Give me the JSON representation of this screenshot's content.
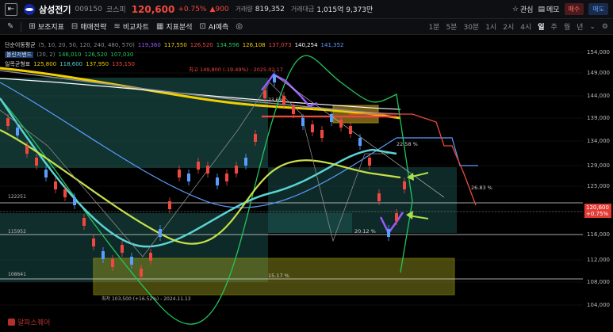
{
  "header": {
    "collapse_icon": "arrow-left-collapse-icon",
    "logo": "samsung-logo",
    "name": "삼성전기",
    "code": "009150",
    "market": "코스피",
    "price": "120,600",
    "change_pct": "+0.75%",
    "change_abs": "▲900",
    "volume_label": "거래량",
    "volume": "819,352",
    "amount_label": "거래대금",
    "amount": "1,015억 9,373만",
    "interest_label": "관심",
    "memo_label": "메모",
    "buy_label": "매수",
    "sell_label": "매도",
    "colors": {
      "up": "#f0483f",
      "down": "#5b9dff",
      "background": "#000000"
    }
  },
  "toolbar": {
    "items": [
      {
        "icon": "ruler-icon",
        "label": ""
      },
      {
        "icon": "indicator-icon",
        "label": "보조지표"
      },
      {
        "icon": "strategy-icon",
        "label": "매매전략"
      },
      {
        "icon": "compare-icon",
        "label": "비교차트"
      },
      {
        "icon": "analysis-icon",
        "label": "지표분석"
      },
      {
        "icon": "ai-icon",
        "label": "AI예측"
      },
      {
        "icon": "camera-icon",
        "label": ""
      }
    ],
    "timeframes": [
      "1분",
      "5분",
      "30분",
      "1시",
      "2시",
      "4시",
      "일",
      "주",
      "월",
      "년"
    ],
    "active_timeframe": "일",
    "dropdown_icon": "chevron-down-icon",
    "settings_icon": "gear-icon"
  },
  "legend": {
    "sma_label": "단순이동평균",
    "sma_params": "(5, 10, 20, 50, 120, 240, 480, 570)",
    "sma_values": [
      "119,360",
      "117,550",
      "126,520",
      "134,596",
      "126,108",
      "137,073",
      "140,254",
      "141,352"
    ],
    "sma_colors": [
      "#9b59ff",
      "#f0d000",
      "#f0483f",
      "#22c55e",
      "#f0d000",
      "#f0483f",
      "#ffffff",
      "#5b9dff"
    ],
    "bb_label": "볼린저밴드",
    "bb_params": "(20, 2)",
    "bb_values": [
      "146,010",
      "126,520",
      "107,030"
    ],
    "ichi_label": "일목균형표",
    "ichi_values": [
      "125,800",
      "118,600",
      "137,950",
      "135,150"
    ]
  },
  "annotations": {
    "high": "최고 149,800 (-19.49%) - 2025.02.17",
    "low": "최저 103,500 (+16.52%) - 2024.11.13",
    "pct_1": "22.58 %",
    "pct_2": "26.83 %",
    "pct_3": "20.12 %",
    "pct_4": "15.17 %",
    "pct_5": "23.6%",
    "level_1": "122251",
    "level_2": "115952",
    "level_3": "108641"
  },
  "price_axis": {
    "ticks": [
      "154,000",
      "149,000",
      "144,000",
      "139,000",
      "134,000",
      "129,000",
      "125,000",
      "120,000",
      "116,000",
      "112,000",
      "108,000",
      "104,000"
    ],
    "current_price": "120,600",
    "current_change": "+0.75%"
  },
  "watermark": "알파스퀘어"
}
